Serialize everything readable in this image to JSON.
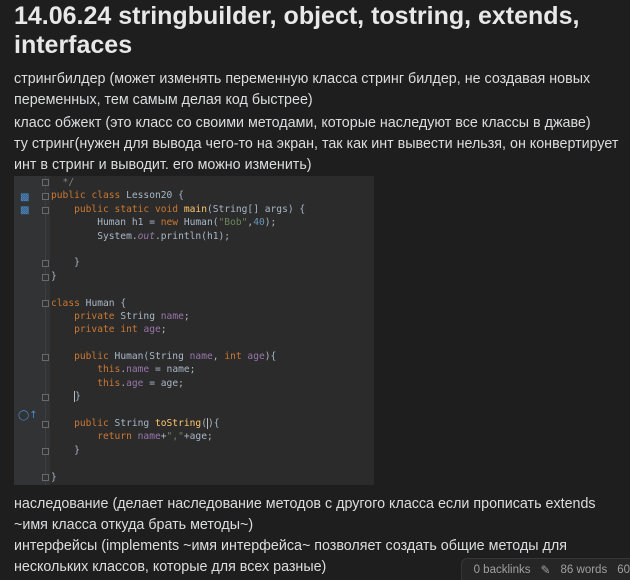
{
  "note": {
    "title": "14.06.24 stringbuilder, object, tostring, extends, interfaces",
    "paragraphs_top": [
      "стрингбилдер (может изменять переменную класса стринг билдер, не создавая новых переменных, тем самым делая код быстрее)",
      "класс обжект (это класс со своими методами, которые наследуют все классы в джаве)",
      "ту стринг(нужен для вывода чего-то на экран, так как инт вывести нельзя, он конвертирует инт в стринг и выводит. его можно изменить)"
    ],
    "paragraphs_bottom": [
      "наследование (делает наследование методов с другого класса если прописать extends ~имя класса откуда брать методы~)",
      "интерфейсы (implements ~имя интерфейса~ позволяет создать общие методы для нескольких классов, которые для всех разные)"
    ]
  },
  "code": {
    "lines": [
      "  */",
      "public class Lesson20 {",
      "    public static void main(String[] args) {",
      "        Human h1 = new Human(\"Bob\",40);",
      "        System.out.println(h1);",
      "",
      "    }",
      "}",
      "",
      "class Human {",
      "    private String name;",
      "    private int age;",
      "",
      "    public Human(String name, int age){",
      "        this.name = name;",
      "        this.age = age;",
      "    }",
      "",
      "    public String toString(){",
      "        return name+\",\"+age;",
      "    }",
      "",
      "}"
    ]
  },
  "status_bar": {
    "backlinks": "0 backlinks",
    "words": "86 words",
    "characters": "60"
  },
  "icons": [
    "run-icon",
    "run-icon",
    "override-icon",
    "edit-pencil-icon"
  ]
}
